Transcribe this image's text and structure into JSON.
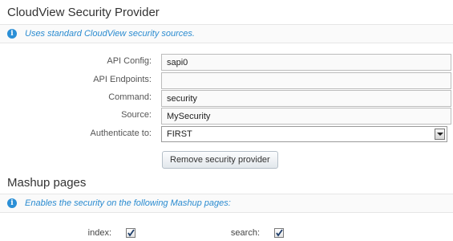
{
  "security": {
    "title": "CloudView Security Provider",
    "info": "Uses standard CloudView security sources.",
    "fields": [
      {
        "label": "API Config:",
        "value": "sapi0"
      },
      {
        "label": "API Endpoints:",
        "value": ""
      },
      {
        "label": "Command:",
        "value": "security"
      },
      {
        "label": "Source:",
        "value": "MySecurity"
      }
    ],
    "authenticate": {
      "label": "Authenticate to:",
      "selected": "FIRST"
    },
    "remove_button": "Remove security provider"
  },
  "mashup": {
    "title": "Mashup pages",
    "info": "Enables the security on the following Mashup pages:",
    "pages": [
      {
        "label": "index:",
        "checked": true
      },
      {
        "label": "search:",
        "checked": true
      }
    ]
  },
  "icons": {
    "info": "info-icon",
    "dropdown": "chevron-down-icon",
    "check": "check-icon"
  },
  "colors": {
    "accent": "#2a8bd0",
    "label": "#555555",
    "border": "#bcbcbc"
  }
}
